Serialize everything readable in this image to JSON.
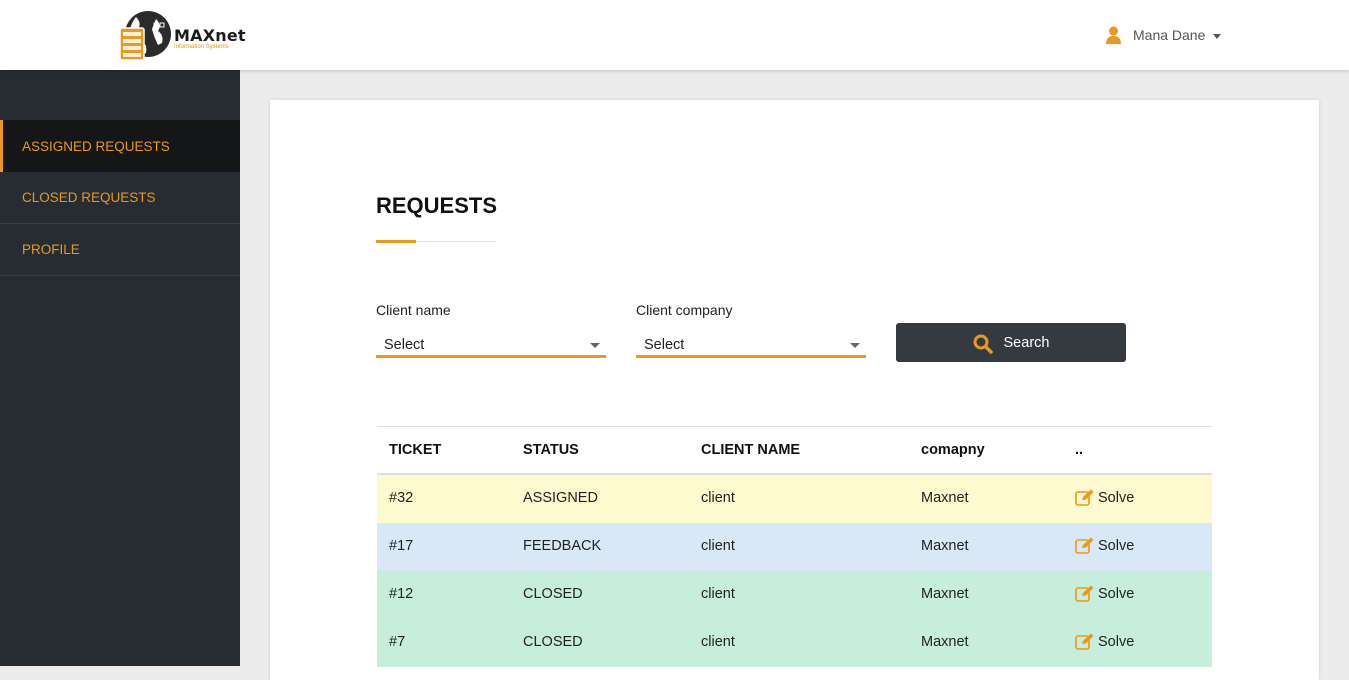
{
  "header": {
    "logo_text": "MAXnet",
    "logo_subtext": "Information Systems",
    "user_name": "Mana Dane"
  },
  "sidebar": {
    "items": [
      {
        "label": "ASSIGNED REQUESTS",
        "active": true
      },
      {
        "label": "CLOSED REQUESTS",
        "active": false
      },
      {
        "label": "PROFILE",
        "active": false
      }
    ]
  },
  "main": {
    "title": "REQUESTS",
    "filters": {
      "client_name_label": "Client name",
      "client_name_value": "Select",
      "client_company_label": "Client company",
      "client_company_value": "Select",
      "search_label": "Search"
    },
    "table": {
      "columns": [
        "TICKET",
        "STATUS",
        "CLIENT NAME",
        "comapny",
        ".."
      ],
      "rows": [
        {
          "ticket": "#32",
          "status": "ASSIGNED",
          "client": "client",
          "company": "Maxnet",
          "action": "Solve",
          "color": "#fff9cf"
        },
        {
          "ticket": "#17",
          "status": "FEEDBACK",
          "client": "client",
          "company": "Maxnet",
          "action": "Solve",
          "color": "#d8e8f6"
        },
        {
          "ticket": "#12",
          "status": "CLOSED",
          "client": "client",
          "company": "Maxnet",
          "action": "Solve",
          "color": "#c7eedb"
        },
        {
          "ticket": "#7",
          "status": "CLOSED",
          "client": "client",
          "company": "Maxnet",
          "action": "Solve",
          "color": "#c7eedb"
        }
      ]
    }
  },
  "colors": {
    "accent": "#e79a1d",
    "sidebar_bg": "#272c33",
    "sidebar_active_bg": "#141618",
    "button_bg": "#343a40"
  },
  "icons": {
    "logo": "globe-server-logo",
    "user": "user-icon",
    "search": "search-icon",
    "solve": "edit-icon"
  }
}
